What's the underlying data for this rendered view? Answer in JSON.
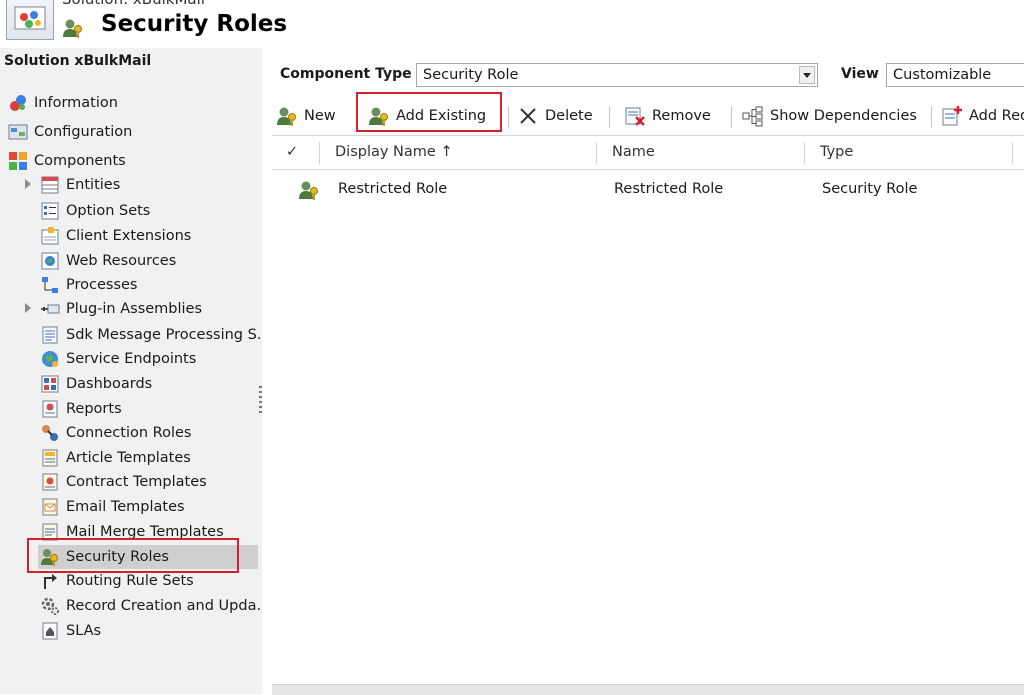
{
  "header": {
    "subtitle": "Solution: xBulkMail",
    "title": "Security Roles"
  },
  "sidebar": {
    "title": "Solution xBulkMail",
    "top_items": [
      {
        "label": "Information",
        "icon": "information-icon"
      },
      {
        "label": "Configuration",
        "icon": "configuration-icon"
      },
      {
        "label": "Components",
        "icon": "components-icon"
      }
    ],
    "components": [
      {
        "label": "Entities",
        "icon": "entities-icon",
        "expandable": true
      },
      {
        "label": "Option Sets",
        "icon": "option-sets-icon"
      },
      {
        "label": "Client Extensions",
        "icon": "client-extensions-icon"
      },
      {
        "label": "Web Resources",
        "icon": "web-resources-icon"
      },
      {
        "label": "Processes",
        "icon": "processes-icon"
      },
      {
        "label": "Plug-in Assemblies",
        "icon": "plugin-assemblies-icon",
        "expandable": true
      },
      {
        "label": "Sdk Message Processing S...",
        "icon": "sdk-message-icon"
      },
      {
        "label": "Service Endpoints",
        "icon": "service-endpoints-icon"
      },
      {
        "label": "Dashboards",
        "icon": "dashboards-icon"
      },
      {
        "label": "Reports",
        "icon": "reports-icon"
      },
      {
        "label": "Connection Roles",
        "icon": "connection-roles-icon"
      },
      {
        "label": "Article Templates",
        "icon": "article-templates-icon"
      },
      {
        "label": "Contract Templates",
        "icon": "contract-templates-icon"
      },
      {
        "label": "Email Templates",
        "icon": "email-templates-icon"
      },
      {
        "label": "Mail Merge Templates",
        "icon": "mail-merge-templates-icon"
      },
      {
        "label": "Security Roles",
        "icon": "security-roles-icon",
        "selected": true
      },
      {
        "label": "Routing Rule Sets",
        "icon": "routing-rule-sets-icon"
      },
      {
        "label": "Record Creation and Upda...",
        "icon": "record-creation-icon"
      },
      {
        "label": "SLAs",
        "icon": "slas-icon"
      }
    ]
  },
  "filter": {
    "component_type_label": "Component Type",
    "component_type_value": "Security Role",
    "view_label": "View",
    "view_value": "Customizable"
  },
  "toolbar": {
    "new": "New",
    "add_existing": "Add Existing",
    "delete": "Delete",
    "remove": "Remove",
    "show_dependencies": "Show Dependencies",
    "add_required": "Add Required Components"
  },
  "grid": {
    "columns": [
      "Display Name ↑",
      "Name",
      "Type"
    ],
    "rows": [
      {
        "display_name": "Restricted Role",
        "name": "Restricted Role",
        "type": "Security Role"
      }
    ]
  },
  "colors": {
    "highlight": "#d4212d",
    "sidebar_bg": "#f1f1f1",
    "selected_bg": "#cfcfcf"
  }
}
